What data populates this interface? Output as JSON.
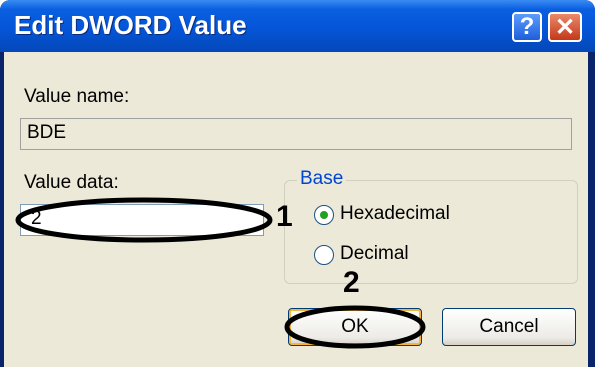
{
  "window": {
    "title": "Edit DWORD Value",
    "help_glyph": "?",
    "close_glyph": "✕"
  },
  "value_name": {
    "label": "Value name:",
    "value": "BDE"
  },
  "value_data": {
    "label": "Value data:",
    "value": "2"
  },
  "base": {
    "title": "Base",
    "options": [
      "Hexadecimal",
      "Decimal"
    ],
    "selected": "Hexadecimal"
  },
  "buttons": {
    "ok": "OK",
    "cancel": "Cancel"
  },
  "annotations": {
    "step1": "1",
    "step2": "2"
  },
  "colors": {
    "titlebar": "#0555d8",
    "dialog_bg": "#ece9d8",
    "group_title": "#0046d5",
    "radio_dot": "#21a121"
  }
}
